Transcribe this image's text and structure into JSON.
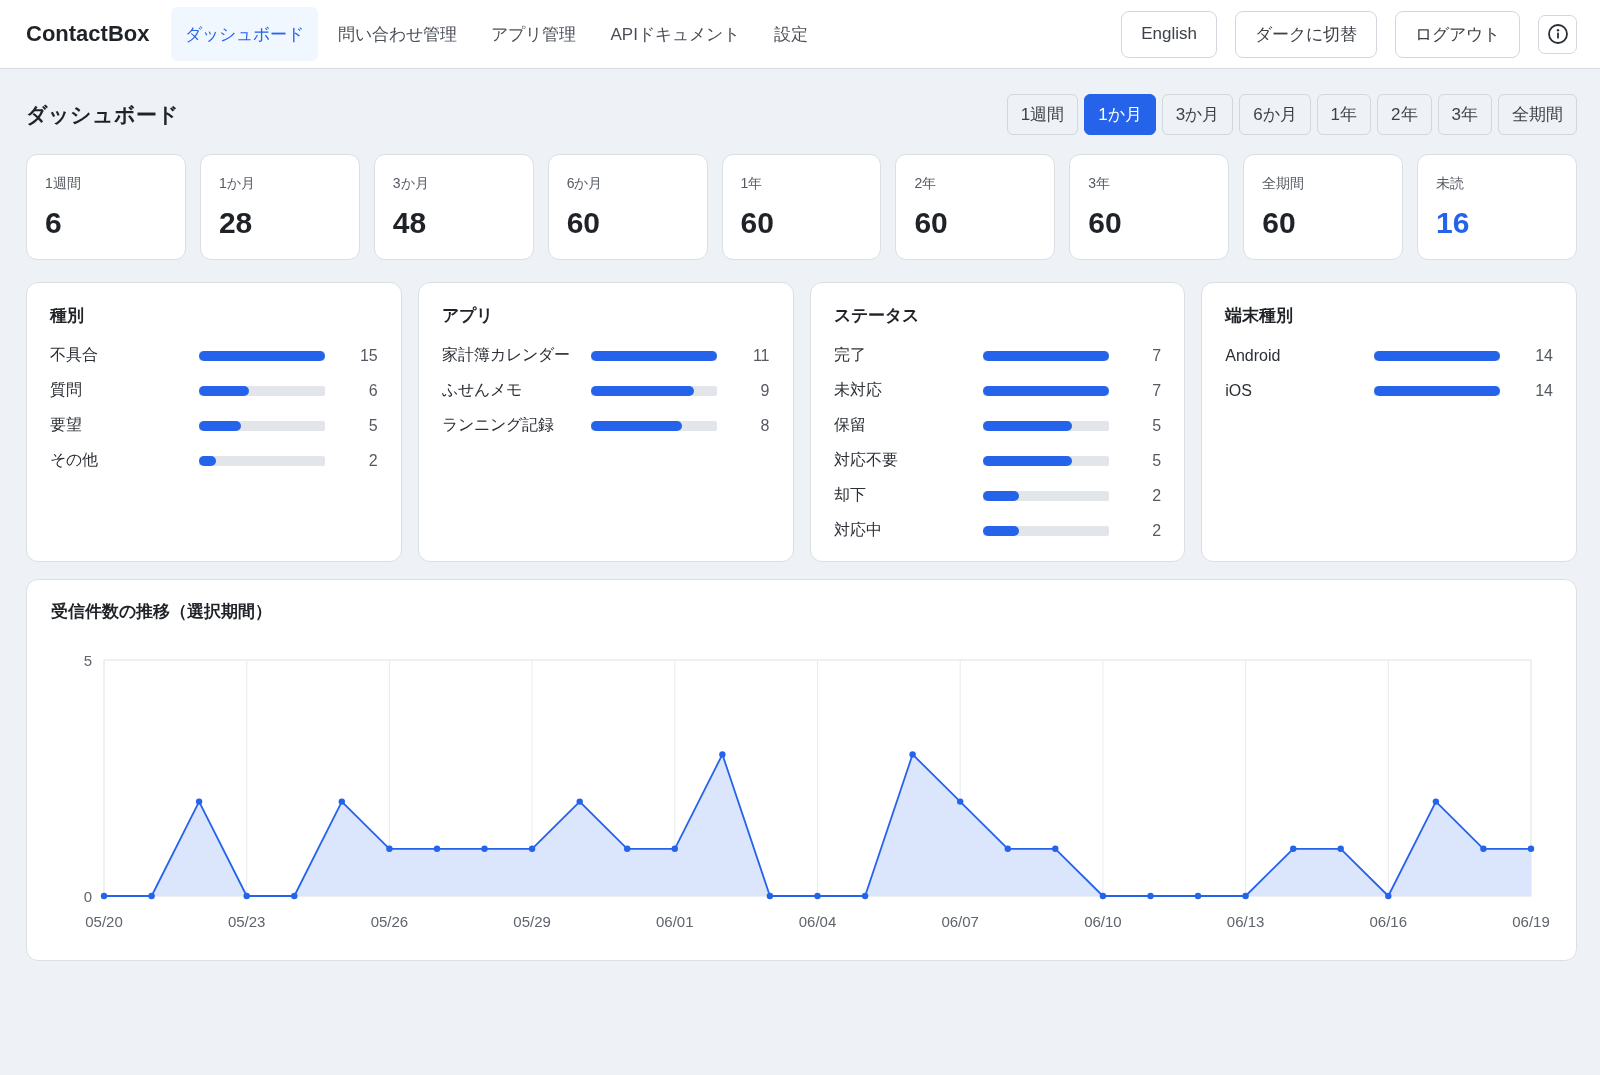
{
  "header": {
    "logo": "ContactBox",
    "nav": [
      {
        "label": "ダッシュボード",
        "selected": true
      },
      {
        "label": "問い合わせ管理",
        "selected": false
      },
      {
        "label": "アプリ管理",
        "selected": false
      },
      {
        "label": "APIドキュメント",
        "selected": false
      },
      {
        "label": "設定",
        "selected": false
      }
    ],
    "buttons": [
      "English",
      "ダークに切替",
      "ログアウト"
    ]
  },
  "page_title": "ダッシュボード",
  "periods": [
    {
      "label": "1週間",
      "selected": false
    },
    {
      "label": "1か月",
      "selected": true
    },
    {
      "label": "3か月",
      "selected": false
    },
    {
      "label": "6か月",
      "selected": false
    },
    {
      "label": "1年",
      "selected": false
    },
    {
      "label": "2年",
      "selected": false
    },
    {
      "label": "3年",
      "selected": false
    },
    {
      "label": "全期間",
      "selected": false
    }
  ],
  "stats": [
    {
      "label": "1週間",
      "value": "6",
      "kind": "total"
    },
    {
      "label": "1か月",
      "value": "28",
      "kind": "total"
    },
    {
      "label": "3か月",
      "value": "48",
      "kind": "total"
    },
    {
      "label": "6か月",
      "value": "60",
      "kind": "total"
    },
    {
      "label": "1年",
      "value": "60",
      "kind": "total"
    },
    {
      "label": "2年",
      "value": "60",
      "kind": "total"
    },
    {
      "label": "3年",
      "value": "60",
      "kind": "total"
    },
    {
      "label": "全期間",
      "value": "60",
      "kind": "total"
    },
    {
      "label": "未読",
      "value": "16",
      "kind": "unread"
    }
  ],
  "breakdowns": [
    {
      "title": "種別",
      "rows": [
        {
          "label": "不具合",
          "value": "15",
          "level": 1
        },
        {
          "label": "質問",
          "value": "6",
          "level": 0.4
        },
        {
          "label": "要望",
          "value": "5",
          "level": 0.333
        },
        {
          "label": "その他",
          "value": "2",
          "level": 0.133
        }
      ]
    },
    {
      "title": "アプリ",
      "rows": [
        {
          "label": "家計簿カレンダー",
          "value": "11",
          "level": 1
        },
        {
          "label": "ふせんメモ",
          "value": "9",
          "level": 0.818
        },
        {
          "label": "ランニング記録",
          "value": "8",
          "level": 0.727
        }
      ]
    },
    {
      "title": "ステータス",
      "rows": [
        {
          "label": "完了",
          "value": "7",
          "level": 1
        },
        {
          "label": "未対応",
          "value": "7",
          "level": 1
        },
        {
          "label": "保留",
          "value": "5",
          "level": 0.714
        },
        {
          "label": "対応不要",
          "value": "5",
          "level": 0.714
        },
        {
          "label": "却下",
          "value": "2",
          "level": 0.286
        },
        {
          "label": "対応中",
          "value": "2",
          "level": 0.286
        }
      ]
    },
    {
      "title": "端末種別",
      "rows": [
        {
          "label": "Android",
          "value": "14",
          "level": 1
        },
        {
          "label": "iOS",
          "value": "14",
          "level": 1
        }
      ]
    }
  ],
  "trend": {
    "chart_data": {
      "type": "area",
      "title": "受信件数の推移（選択期間）",
      "categories": [
        "05/20",
        null,
        null,
        "05/23",
        null,
        null,
        "05/26",
        null,
        null,
        "05/29",
        null,
        null,
        "06/01",
        null,
        null,
        "06/04",
        null,
        null,
        "06/07",
        null,
        null,
        "06/10",
        null,
        null,
        "06/13",
        null,
        null,
        "06/16",
        null,
        null,
        "06/19"
      ],
      "values": [
        0,
        0,
        2,
        0,
        0,
        2,
        1,
        1,
        1,
        1,
        2,
        1,
        1,
        3,
        0,
        0,
        0,
        3,
        2,
        1,
        1,
        0,
        0,
        0,
        0,
        1,
        1,
        0,
        2,
        1,
        1
      ],
      "ylim": [
        0,
        5
      ],
      "yticks": [
        0,
        5
      ],
      "grid": true
    }
  }
}
